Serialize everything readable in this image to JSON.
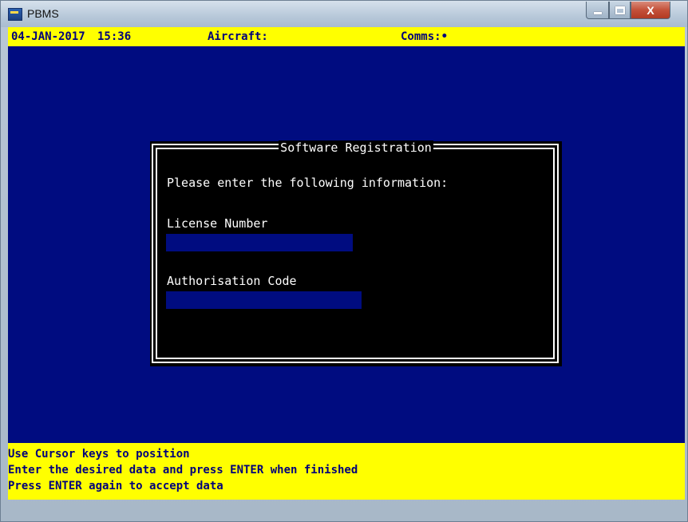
{
  "window": {
    "title": "PBMS",
    "close_label": "X"
  },
  "status": {
    "date": "04-JAN-2017",
    "time": "15:36",
    "aircraft_label": "Aircraft:",
    "comms_label": "Comms:•"
  },
  "dialog": {
    "title": "Software Registration",
    "prompt": "Please enter the following information:",
    "license_label": "License Number",
    "license_value": "",
    "auth_label": "Authorisation Code",
    "auth_value": ""
  },
  "help": {
    "lines": [
      "Use Cursor keys to position",
      "Enter the desired data and press ENTER when finished",
      "Press ENTER again to accept data"
    ]
  },
  "colors": {
    "screen_background": "#000c80",
    "bar_background": "#ffff00",
    "bar_text": "#00007a",
    "dialog_background": "#000000"
  }
}
